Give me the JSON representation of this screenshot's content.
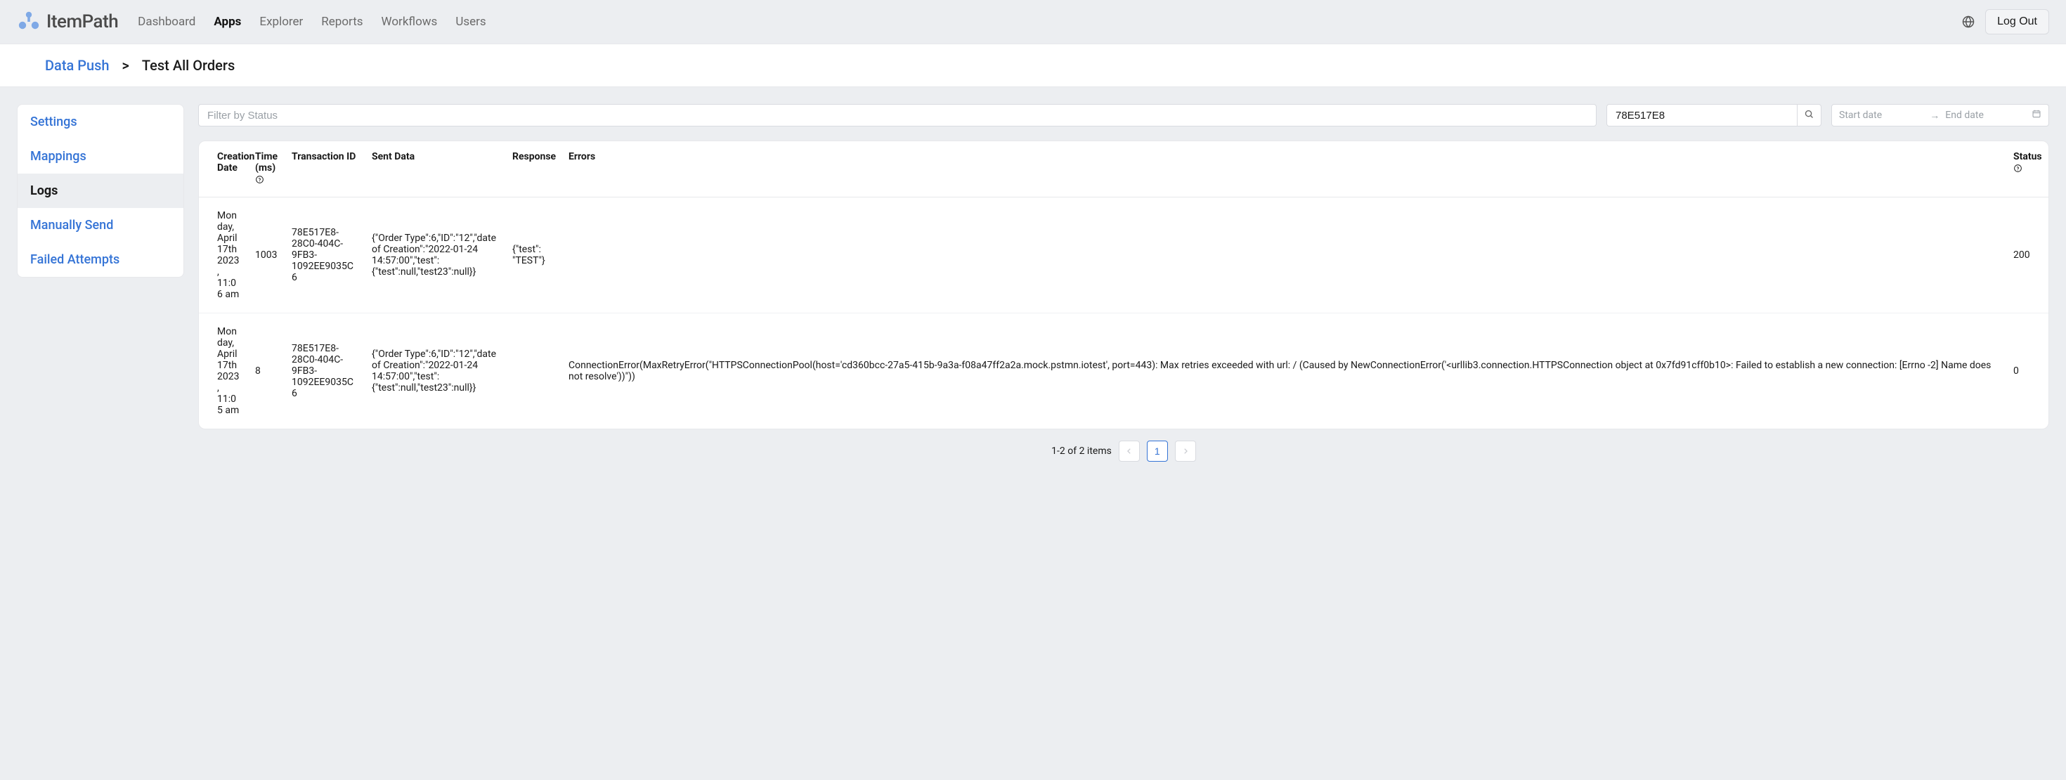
{
  "brand": "ItemPath",
  "nav": {
    "items": [
      {
        "label": "Dashboard",
        "active": false
      },
      {
        "label": "Apps",
        "active": true
      },
      {
        "label": "Explorer",
        "active": false
      },
      {
        "label": "Reports",
        "active": false
      },
      {
        "label": "Workflows",
        "active": false
      },
      {
        "label": "Users",
        "active": false
      }
    ],
    "logout_label": "Log Out"
  },
  "breadcrumb": {
    "parent": "Data Push",
    "separator": ">",
    "current": "Test All Orders"
  },
  "sidebar": {
    "items": [
      {
        "label": "Settings",
        "active": false
      },
      {
        "label": "Mappings",
        "active": false
      },
      {
        "label": "Logs",
        "active": true
      },
      {
        "label": "Manually Send",
        "active": false
      },
      {
        "label": "Failed Attempts",
        "active": false
      }
    ]
  },
  "filters": {
    "status_placeholder": "Filter by Status",
    "search_value": "78E517E8",
    "date_start_placeholder": "Start date",
    "date_end_placeholder": "End date",
    "date_arrow": "→"
  },
  "table": {
    "headers": {
      "creation_date": "Creation Date",
      "time_ms": "Time (ms)",
      "transaction_id": "Transaction ID",
      "sent_data": "Sent Data",
      "response": "Response",
      "errors": "Errors",
      "status": "Status"
    },
    "rows": [
      {
        "creation_date": "Monday, April 17th 2023, 11:06 am",
        "time_ms": "1003",
        "transaction_id": "78E517E8-28C0-404C-9FB3-1092EE9035C6",
        "sent_data": "{\"Order Type\":6,\"ID\":\"12\",\"date of Creation\":\"2022-01-24 14:57:00\",\"test\":{\"test\":null,\"test23\":null}}",
        "response": "{\"test\": \"TEST\"}",
        "errors": "",
        "status": "200"
      },
      {
        "creation_date": "Monday, April 17th 2023, 11:05 am",
        "time_ms": "8",
        "transaction_id": "78E517E8-28C0-404C-9FB3-1092EE9035C6",
        "sent_data": "{\"Order Type\":6,\"ID\":\"12\",\"date of Creation\":\"2022-01-24 14:57:00\",\"test\":{\"test\":null,\"test23\":null}}",
        "response": "",
        "errors": "ConnectionError(MaxRetryError(\"HTTPSConnectionPool(host='cd360bcc-27a5-415b-9a3a-f08a47ff2a2a.mock.pstmn.iotest', port=443): Max retries exceeded with url: / (Caused by NewConnectionError('<urllib3.connection.HTTPSConnection object at 0x7fd91cff0b10>: Failed to establish a new connection: [Errno -2] Name does not resolve'))\"))",
        "status": "0"
      }
    ]
  },
  "pagination": {
    "summary": "1-2 of 2 items",
    "current_page": "1"
  }
}
